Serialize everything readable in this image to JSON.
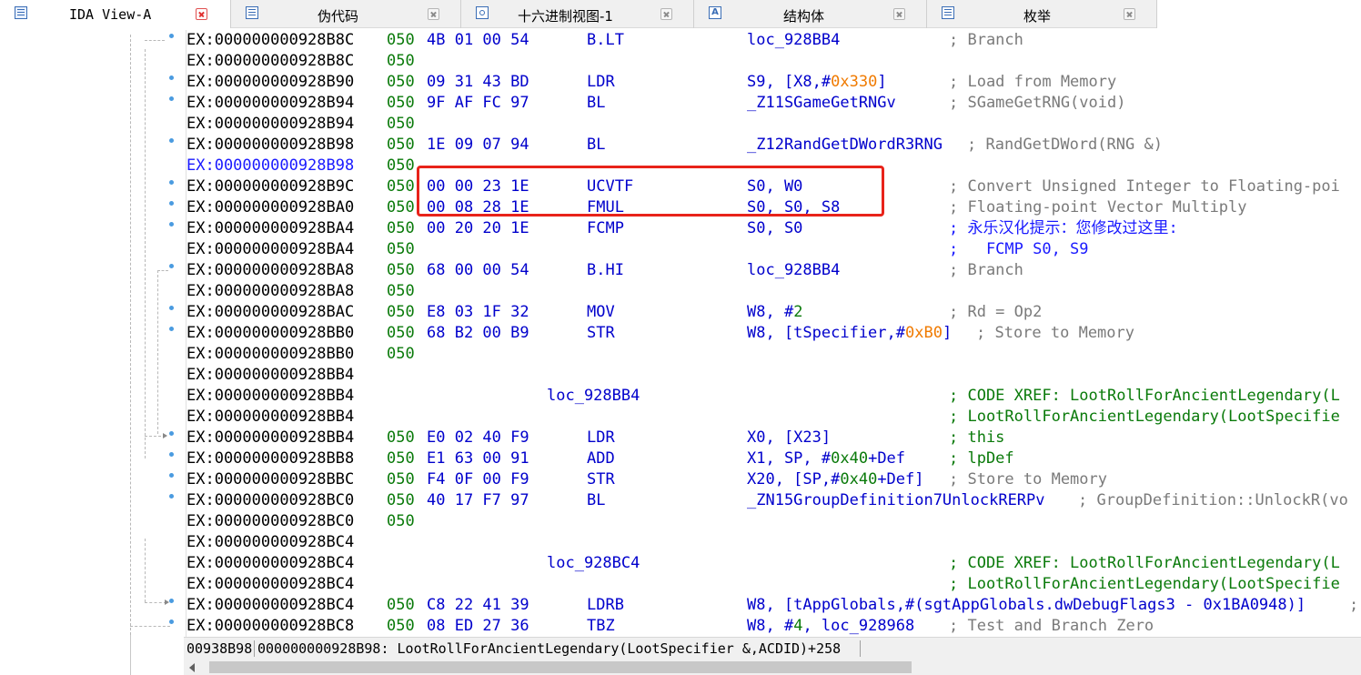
{
  "tabs": [
    {
      "label": "IDA View-A",
      "icon": "ida-view-icon",
      "active": true
    },
    {
      "label": "伪代码",
      "icon": "pseudocode-icon",
      "active": false
    },
    {
      "label": "十六进制视图-1",
      "icon": "hex-view-icon",
      "active": false
    },
    {
      "label": "结构体",
      "icon": "structures-icon",
      "active": false
    },
    {
      "label": "枚举",
      "icon": "enums-icon",
      "active": false
    }
  ],
  "lines": [
    {
      "addr": "EX:000000000928B8C",
      "op": "050",
      "hex": "4B 01 00 54",
      "mn": "B.LT",
      "arg": "loc_928BB4",
      "cmt": "; Branch"
    },
    {
      "addr": "EX:000000000928B8C",
      "op": "050"
    },
    {
      "addr": "EX:000000000928B90",
      "op": "050",
      "hex": "09 31 43 BD",
      "mn": "LDR",
      "arg_a": "S9, [X8,#",
      "arg_b": "0x330",
      "arg_c": "]",
      "cmt": "; Load from Memory"
    },
    {
      "addr": "EX:000000000928B94",
      "op": "050",
      "hex": "9F AF FC 97",
      "mn": "BL",
      "arg": "_Z11SGameGetRNGv",
      "cmt": "; SGameGetRNG(void)"
    },
    {
      "addr": "EX:000000000928B94",
      "op": "050"
    },
    {
      "addr": "EX:000000000928B98",
      "op": "050",
      "hex": "1E 09 07 94",
      "mn": "BL",
      "arg": "_Z12RandGetDWordR3RNG",
      "cmt": "; RandGetDWord(RNG &)"
    },
    {
      "addr": "EX:000000000928B98",
      "op": "050"
    },
    {
      "addr": "EX:000000000928B9C",
      "op": "050",
      "hex": "00 00 23 1E",
      "mn": "UCVTF",
      "arg": "S0, W0",
      "cmt": "; Convert Unsigned Integer to Floating-poi"
    },
    {
      "addr": "EX:000000000928BA0",
      "op": "050",
      "hex": "00 08 28 1E",
      "mn": "FMUL",
      "arg": "S0, S0, S8",
      "cmt": "; Floating-point Vector Multiply"
    },
    {
      "addr": "EX:000000000928BA4",
      "op": "050",
      "hex": "00 20 20 1E",
      "mn": "FCMP",
      "arg": "S0, S0",
      "cmt": "; 永乐汉化提示：您修改过这里:"
    },
    {
      "addr": "EX:000000000928BA4",
      "op": "050",
      "cmt": ";   FCMP S0, S9"
    },
    {
      "addr": "EX:000000000928BA8",
      "op": "050",
      "hex": "68 00 00 54",
      "mn": "B.HI",
      "arg": "loc_928BB4",
      "cmt": "; Branch"
    },
    {
      "addr": "EX:000000000928BA8",
      "op": "050"
    },
    {
      "addr": "EX:000000000928BAC",
      "op": "050",
      "hex": "E8 03 1F 32",
      "mn": "MOV",
      "arg_a": "W8, #",
      "arg_b": "2",
      "cmt": "; Rd = Op2"
    },
    {
      "addr": "EX:000000000928BB0",
      "op": "050",
      "hex": "68 B2 00 B9",
      "mn": "STR",
      "arg_a": "W8, [tSpecifier,#",
      "arg_b": "0xB0",
      "arg_c": "]",
      "cmt": "; Store to Memory"
    },
    {
      "addr": "EX:000000000928BB0",
      "op": "050"
    },
    {
      "addr": "EX:000000000928BB4"
    },
    {
      "addr": "EX:000000000928BB4",
      "label": "loc_928BB4",
      "cmt": "; CODE XREF: LootRollForAncientLegendary(L"
    },
    {
      "addr": "EX:000000000928BB4",
      "cmt": "; LootRollForAncientLegendary(LootSpecifie"
    },
    {
      "addr": "EX:000000000928BB4",
      "op": "050",
      "hex": "E0 02 40 F9",
      "mn": "LDR",
      "arg": "X0, [X23]",
      "cmt": "; this"
    },
    {
      "addr": "EX:000000000928BB8",
      "op": "050",
      "hex": "E1 63 00 91",
      "mn": "ADD",
      "arg_a": "X1, SP, #",
      "arg_b": "0x40",
      "arg_c": "+Def",
      "cmt": "; lpDef"
    },
    {
      "addr": "EX:000000000928BBC",
      "op": "050",
      "hex": "F4 0F 00 F9",
      "mn": "STR",
      "arg_a": "X20, [SP,#",
      "arg_b": "0x40",
      "arg_c": "+Def]",
      "cmt": "; Store to Memory"
    },
    {
      "addr": "EX:000000000928BC0",
      "op": "050",
      "hex": "40 17 F7 97",
      "mn": "BL",
      "arg": "_ZN15GroupDefinition7UnlockRERPv",
      "cmt": "; GroupDefinition::UnlockR(vo"
    },
    {
      "addr": "EX:000000000928BC0",
      "op": "050"
    },
    {
      "addr": "EX:000000000928BC4"
    },
    {
      "addr": "EX:000000000928BC4",
      "label": "loc_928BC4",
      "cmt": "; CODE XREF: LootRollForAncientLegendary(L"
    },
    {
      "addr": "EX:000000000928BC4",
      "cmt": "; LootRollForAncientLegendary(LootSpecifie"
    },
    {
      "addr": "EX:000000000928BC4",
      "op": "050",
      "hex": "C8 22 41 39",
      "mn": "LDRB",
      "arg_a": "W8, [tAppGlobals,#(sgtAppGlobals.dwDebugFlags3 - ",
      "arg_b": "0x1BA0948",
      "arg_c": ")]",
      "cmt": ";"
    },
    {
      "addr": "EX:000000000928BC8",
      "op": "050",
      "hex": "08 ED 27 36",
      "mn": "TBZ",
      "arg_a": "W8, #",
      "arg_b": "4",
      "arg_c": ", loc_928968",
      "cmt": "; Test and Branch Zero"
    }
  ],
  "status": {
    "offset": "00938B98",
    "location": "000000000928B98: LootRollForAncientLegendary(LootSpecifier &,ACDID)+258"
  },
  "colors": {
    "highlight_box": "#e8231a",
    "address": "#000000",
    "opcode": "#0a7a0a",
    "instruction": "#0000cc",
    "comment": "#7a7a7a"
  }
}
